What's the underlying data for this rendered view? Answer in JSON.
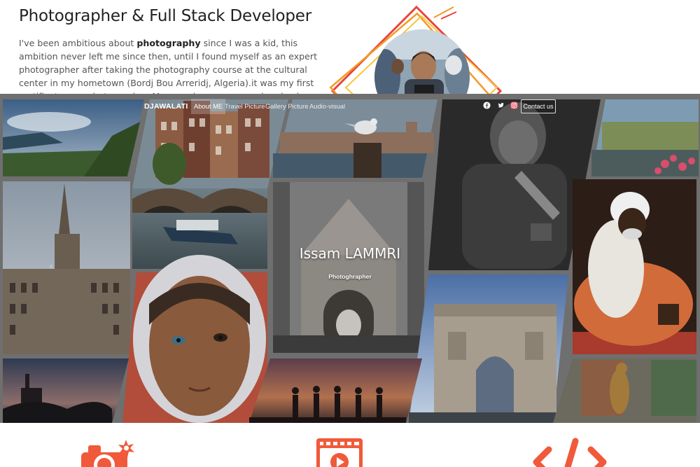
{
  "about": {
    "title": "Photographer & Full Stack Developer",
    "text_before": "I've been ambitious about ",
    "text_bold": "photography",
    "text_after": " since I was a kid, this ambition never left me since then, until I found myself as an expert photographer after taking the photography course at the cultural center in my hometown (Bordj Bou Arreridj, Algeria).it was my first certificate as a photographer. My experience was growing day by day taking good and bad pictures, learning from my"
  },
  "navbar": {
    "brand": "DJAWALATI",
    "items": [
      {
        "label": "About ME",
        "active": true
      },
      {
        "label": "Travel Picture",
        "active": false
      },
      {
        "label": "Gallery Picture",
        "active": false
      },
      {
        "label": "Audio-visual",
        "active": false
      }
    ],
    "social": [
      "facebook-icon",
      "twitter-icon",
      "instagram-icon"
    ],
    "contact_label": "Contact us"
  },
  "hero": {
    "name": "Issam LAMMRI",
    "role": "Photoghrapher",
    "prev_icon": "chevron-left-icon"
  },
  "services": {
    "icons": [
      "camera-icon",
      "video-player-icon",
      "code-icon"
    ],
    "accent": "#f05a3a"
  },
  "colors": {
    "accent": "#f05a3a",
    "frame_gray": "#6f6f6f"
  }
}
